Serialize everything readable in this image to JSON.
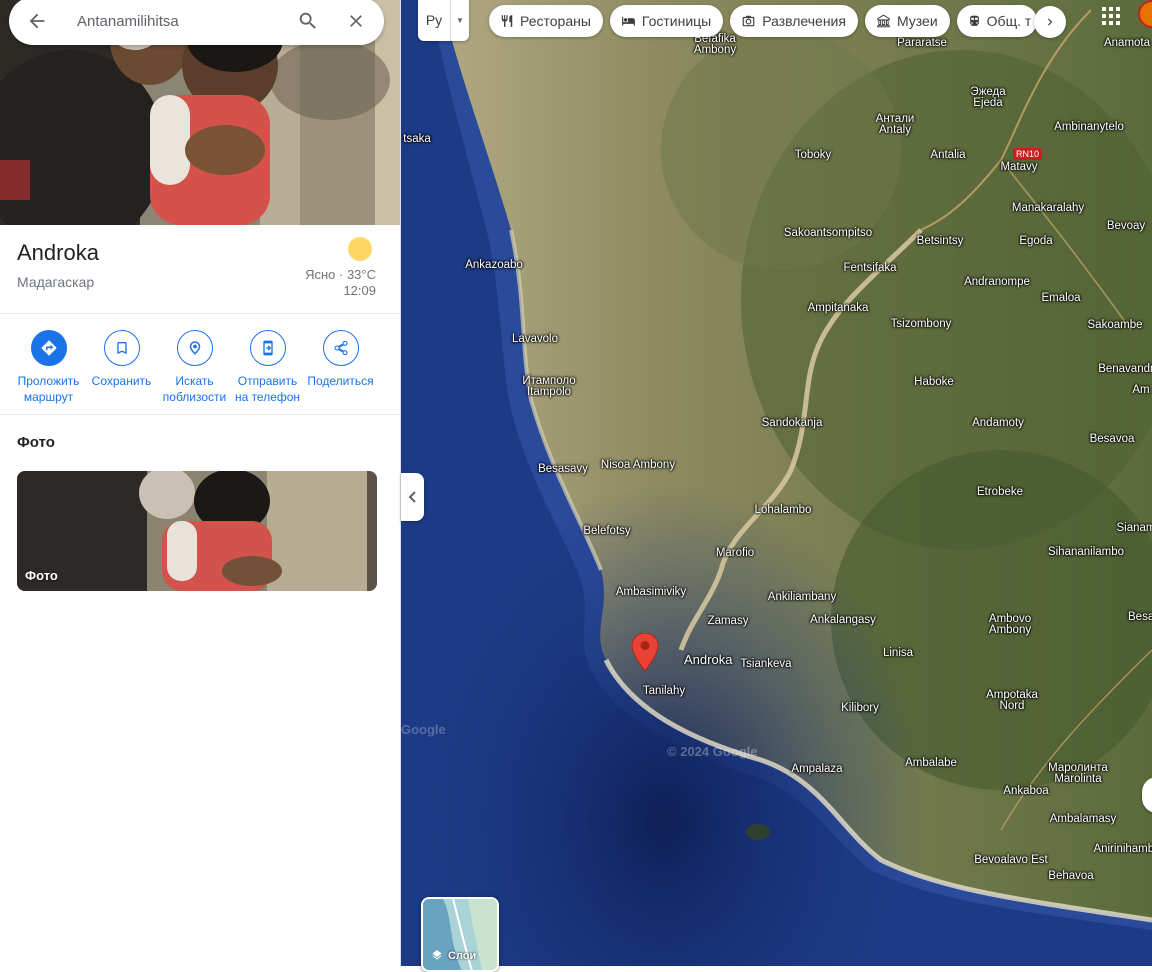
{
  "search": {
    "value": "Antanamilihitsa",
    "back_icon": "arrow-back-icon",
    "search_icon": "search-icon",
    "clear_icon": "close-icon"
  },
  "place": {
    "title": "Androka",
    "subtitle": "Мадагаскар"
  },
  "weather": {
    "condition": "Ясно · 33°C",
    "time": "12:09",
    "icon": "sun-icon"
  },
  "actions": [
    {
      "label": "Проложить\nмаршрут",
      "icon": "directions-icon"
    },
    {
      "label": "Сохранить",
      "icon": "bookmark-icon"
    },
    {
      "label": "Искать\nпоблизости",
      "icon": "nearby-icon"
    },
    {
      "label": "Отправить\nна телефон",
      "icon": "send-to-phone-icon"
    },
    {
      "label": "Поделиться",
      "icon": "share-icon"
    }
  ],
  "photos": {
    "heading": "Фото",
    "card_caption": "Фото"
  },
  "map_controls": {
    "language_code": "Ру",
    "chips": [
      {
        "label": "Рестораны",
        "icon": "restaurant-icon"
      },
      {
        "label": "Гостиницы",
        "icon": "hotel-icon"
      },
      {
        "label": "Развлечения",
        "icon": "camera-icon"
      },
      {
        "label": "Музеи",
        "icon": "museum-icon"
      },
      {
        "label": "Общ. т",
        "icon": "transit-icon"
      }
    ],
    "layers_label": "Слои",
    "road_shield": "RN10"
  },
  "map_labels": [
    {
      "text": "Befafika\nAmbony"
    },
    {
      "text": "Pararatse"
    },
    {
      "text": "Anamota"
    },
    {
      "text": "Эжеда\nEjeda"
    },
    {
      "text": "Антали\nAntaly"
    },
    {
      "text": "Ambinanytelo"
    },
    {
      "text": "Toboky"
    },
    {
      "text": "Antalia"
    },
    {
      "text": "Matavy"
    },
    {
      "text": "tsaka"
    },
    {
      "text": "Manakaralahy"
    },
    {
      "text": "Bevoay"
    },
    {
      "text": "Sakoantsompitso"
    },
    {
      "text": "Betsintsy"
    },
    {
      "text": "Egoda"
    },
    {
      "text": "Ankazoabo"
    },
    {
      "text": "Fentsifaka"
    },
    {
      "text": "Andranompe"
    },
    {
      "text": "Emaloa"
    },
    {
      "text": "Ampitanaka"
    },
    {
      "text": "Tsizombony"
    },
    {
      "text": "Sakoambe"
    },
    {
      "text": "Lavavolo"
    },
    {
      "text": "Benavandr"
    },
    {
      "text": "Итамполо\nItampolo"
    },
    {
      "text": "Haboke"
    },
    {
      "text": "Am"
    },
    {
      "text": "Sandokanja"
    },
    {
      "text": "Andamoty"
    },
    {
      "text": "Besavoa"
    },
    {
      "text": "Besasavy"
    },
    {
      "text": "Nisoa Ambony"
    },
    {
      "text": "Etrobeke"
    },
    {
      "text": "Lohalambo"
    },
    {
      "text": "Belefotsy"
    },
    {
      "text": "Sianam"
    },
    {
      "text": "Marofio"
    },
    {
      "text": "Sihananilambo"
    },
    {
      "text": "Ambasimiviky"
    },
    {
      "text": "Ankiliambany"
    },
    {
      "text": "Zamasy"
    },
    {
      "text": "Ankalangasy"
    },
    {
      "text": "Ambovo\nAmbony"
    },
    {
      "text": "Besak"
    },
    {
      "text": "Linisa"
    },
    {
      "text": "Androka"
    },
    {
      "text": "Tsiankeva"
    },
    {
      "text": "Tanilahy"
    },
    {
      "text": "Ampotaka\nNord"
    },
    {
      "text": "Kilibory"
    },
    {
      "text": "Ambalabe"
    },
    {
      "text": "Маролинта\nMarolinta"
    },
    {
      "text": "Ampalaza"
    },
    {
      "text": "Ankaboa"
    },
    {
      "text": "Ambalamasy"
    },
    {
      "text": "Anirinihamba"
    },
    {
      "text": "Bevoalavo Est"
    },
    {
      "text": "Behavoa"
    }
  ],
  "watermarks": [
    "Google",
    "© 2024 Google"
  ],
  "colors": {
    "accent": "#1a73e8",
    "ocean": "#1d3a86",
    "pin": "#ea4335"
  }
}
